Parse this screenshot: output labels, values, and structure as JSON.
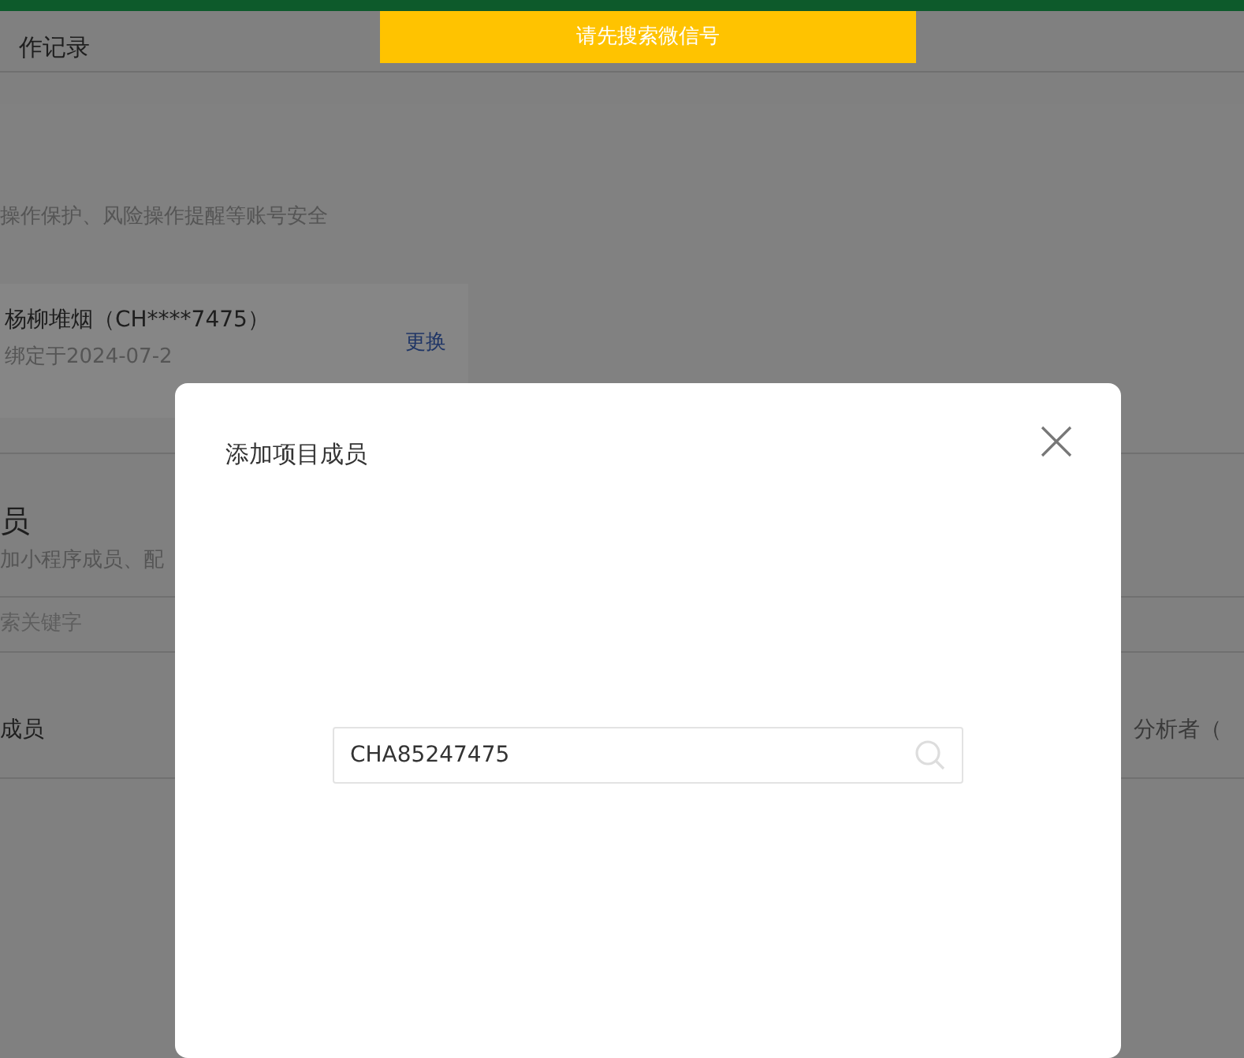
{
  "toast": {
    "text": "请先搜索微信号"
  },
  "page": {
    "section_title": "作记录",
    "security": {
      "description": "操作保护、风险操作提醒等账号安全",
      "account_name": "杨柳堆烟（CH****7475）",
      "bound_date": "绑定于2024-07-2",
      "change_link": "更换"
    },
    "members": {
      "title": "员",
      "description": "加小程序成员、配",
      "search_placeholder": "索关键字",
      "row_label": "成员",
      "row_role": "分析者（"
    }
  },
  "dialog": {
    "title": "添加项目成员",
    "search": {
      "value": "CHA85247475"
    }
  }
}
